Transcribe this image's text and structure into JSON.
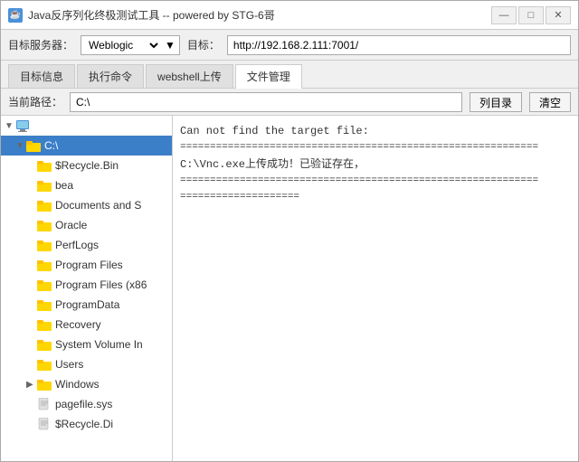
{
  "window": {
    "title": "Java反序列化终极测试工具  --  powered by STG-6哥",
    "icon": "☕"
  },
  "title_controls": {
    "minimize": "—",
    "maximize": "□",
    "close": "✕"
  },
  "toolbar": {
    "server_label": "目标服务器：",
    "server_value": "Weblogic",
    "target_label": "目标：",
    "target_value": "http://192.168.2.111:7001/"
  },
  "tabs": [
    {
      "label": "目标信息",
      "active": false
    },
    {
      "label": "执行命令",
      "active": false
    },
    {
      "label": "webshell上传",
      "active": false
    },
    {
      "label": "文件管理",
      "active": true
    }
  ],
  "path_bar": {
    "label": "当前路径：",
    "value": "C:\\",
    "list_btn": "列目录",
    "clear_btn": "清空"
  },
  "tree": {
    "items": [
      {
        "label": "▼",
        "text": "",
        "indent": 0,
        "type": "computer",
        "expanded": true,
        "selected": false
      },
      {
        "label": "▼",
        "text": "C:\\",
        "indent": 1,
        "type": "folder",
        "expanded": true,
        "selected": true
      },
      {
        "label": "",
        "text": "$Recycle.Bin",
        "indent": 2,
        "type": "folder",
        "selected": false
      },
      {
        "label": "",
        "text": "bea",
        "indent": 2,
        "type": "folder",
        "selected": false
      },
      {
        "label": "",
        "text": "Documents and S",
        "indent": 2,
        "type": "folder",
        "selected": false
      },
      {
        "label": "",
        "text": "Oracle",
        "indent": 2,
        "type": "folder",
        "selected": false
      },
      {
        "label": "",
        "text": "PerfLogs",
        "indent": 2,
        "type": "folder",
        "selected": false
      },
      {
        "label": "",
        "text": "Program Files",
        "indent": 2,
        "type": "folder",
        "selected": false
      },
      {
        "label": "",
        "text": "Program Files (x86",
        "indent": 2,
        "type": "folder",
        "selected": false
      },
      {
        "label": "",
        "text": "ProgramData",
        "indent": 2,
        "type": "folder",
        "selected": false
      },
      {
        "label": "",
        "text": "Recovery",
        "indent": 2,
        "type": "folder",
        "selected": false
      },
      {
        "label": "",
        "text": "System Volume In",
        "indent": 2,
        "type": "folder",
        "selected": false
      },
      {
        "label": "",
        "text": "Users",
        "indent": 2,
        "type": "folder",
        "selected": false
      },
      {
        "label": "▶",
        "text": "Windows",
        "indent": 2,
        "type": "folder",
        "selected": false
      },
      {
        "label": "",
        "text": "pagefile.sys",
        "indent": 2,
        "type": "file",
        "selected": false
      },
      {
        "label": "",
        "text": "$Recycle.Di",
        "indent": 2,
        "type": "file",
        "selected": false
      }
    ]
  },
  "output": {
    "lines": [
      {
        "text": "Can not find the target file:",
        "type": "normal"
      },
      {
        "text": "============================================================",
        "type": "divider"
      },
      {
        "text": "C:\\Vnc.exe上传成功！已验证存在，",
        "type": "normal"
      },
      {
        "text": "============================================================",
        "type": "divider"
      },
      {
        "text": "====================",
        "type": "divider"
      }
    ]
  },
  "colors": {
    "selected_bg": "#3c7fc9",
    "folder_yellow": "#ffd700",
    "accent": "#4a90d9"
  }
}
